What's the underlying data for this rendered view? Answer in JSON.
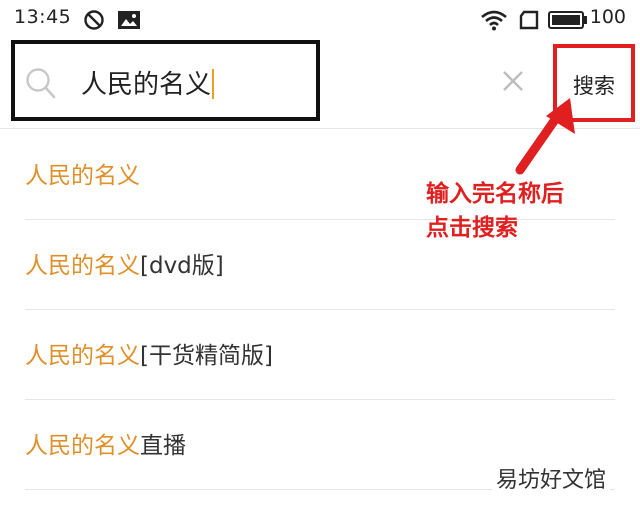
{
  "status_bar": {
    "time": "13:45",
    "battery": "100",
    "icons": [
      "do-not-disturb-icon",
      "image-icon",
      "wifi-icon",
      "sim-card-icon",
      "battery-icon"
    ]
  },
  "search": {
    "query": "人民的名义",
    "submit_label": "搜索",
    "clear_icon": "close-icon",
    "search_icon": "search-icon"
  },
  "suggestions": [
    {
      "highlight": "人民的名义",
      "suffix": ""
    },
    {
      "highlight": "人民的名义",
      "suffix": "[dvd版]"
    },
    {
      "highlight": "人民的名义",
      "suffix": "[干货精简版]"
    },
    {
      "highlight": "人民的名义",
      "suffix": "直播"
    }
  ],
  "annotation": {
    "line1": "输入完名称后",
    "line2": "点击搜索",
    "color": "#e02020"
  },
  "watermark": "易坊好文馆",
  "colors": {
    "highlight": "#e0902a",
    "annotation_red": "#e02020",
    "divider": "#e6e6e6"
  }
}
